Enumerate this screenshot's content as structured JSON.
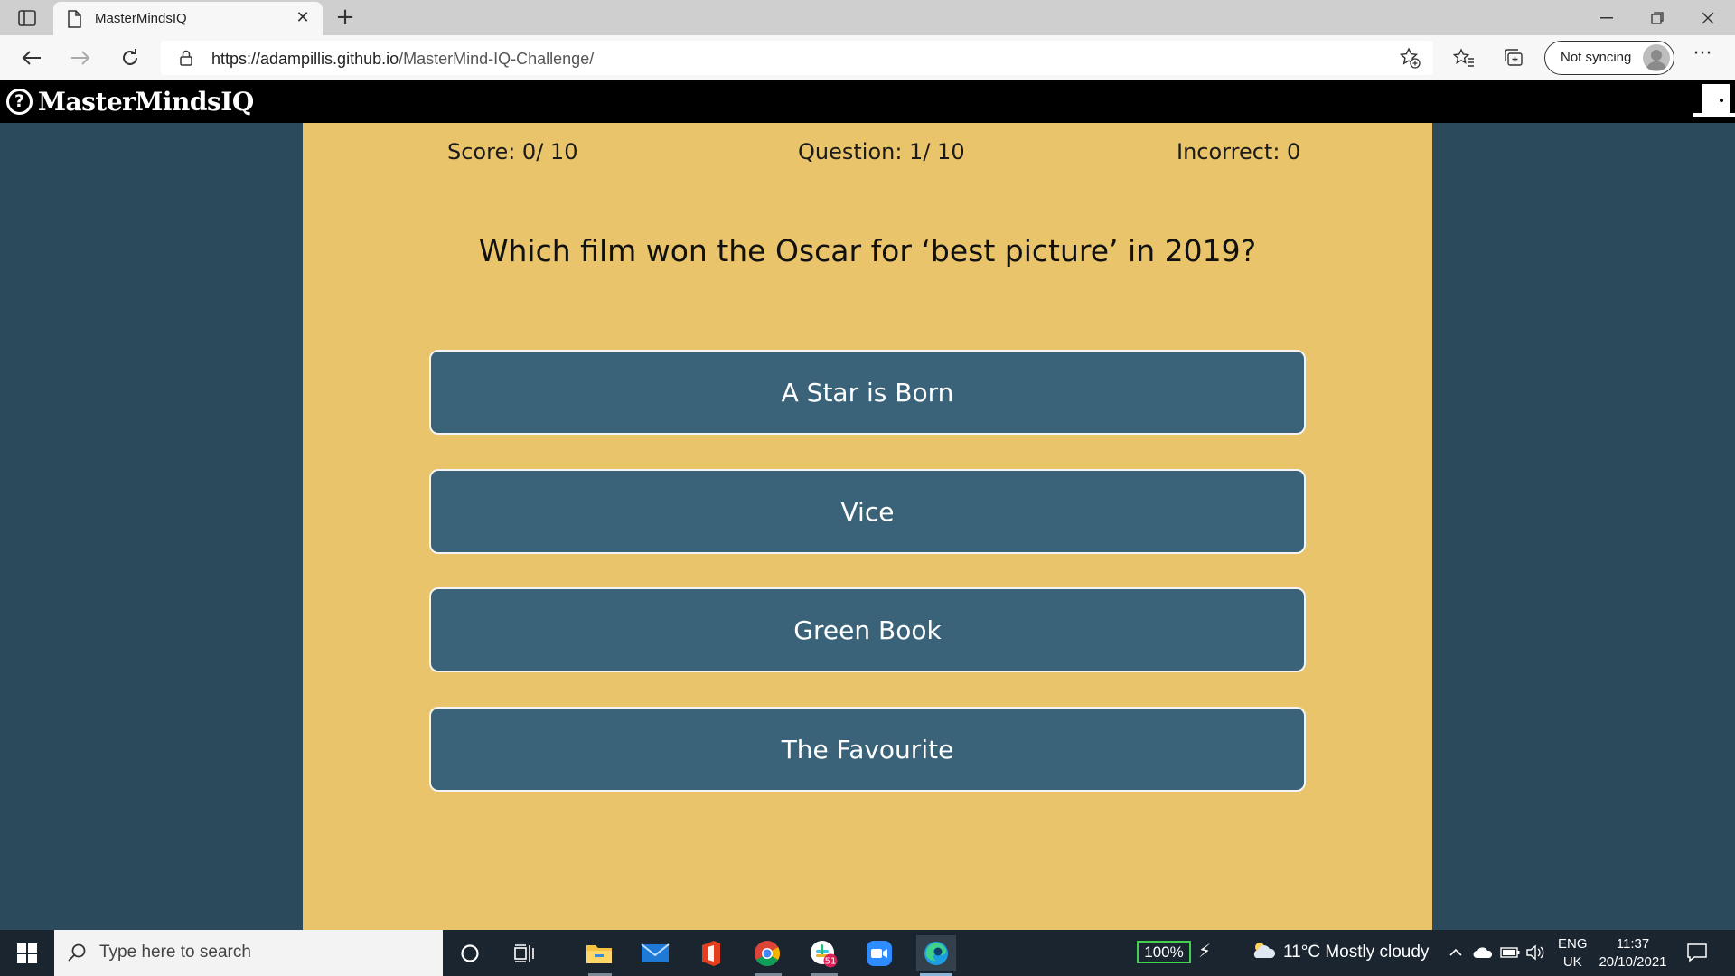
{
  "browser": {
    "tab_title": "MasterMindsIQ",
    "url_host": "https://adampillis.github.io",
    "url_path": "/MasterMind-IQ-Challenge/",
    "sync_label": "Not syncing"
  },
  "app": {
    "brand": "MasterMindsIQ",
    "logo_glyph": "?"
  },
  "quiz": {
    "score": "Score: 0/ 10",
    "question_counter": "Question: 1/ 10",
    "incorrect": "Incorrect: 0",
    "question": "Which film won the Oscar for ‘best picture’ in 2019?",
    "answers": [
      "A Star is Born",
      "Vice",
      "Green Book",
      "The Favourite"
    ]
  },
  "taskbar": {
    "search_placeholder": "Type here to search",
    "battery": "100%",
    "weather": "11°C  Mostly cloudy",
    "lang_1": "ENG",
    "lang_2": "UK",
    "time": "11:37",
    "date": "20/10/2021",
    "badge_count": "51"
  },
  "colors": {
    "panel": "#e9c46a",
    "background": "#2b4a5c",
    "answer_button": "#3a6379",
    "header": "#000000"
  }
}
